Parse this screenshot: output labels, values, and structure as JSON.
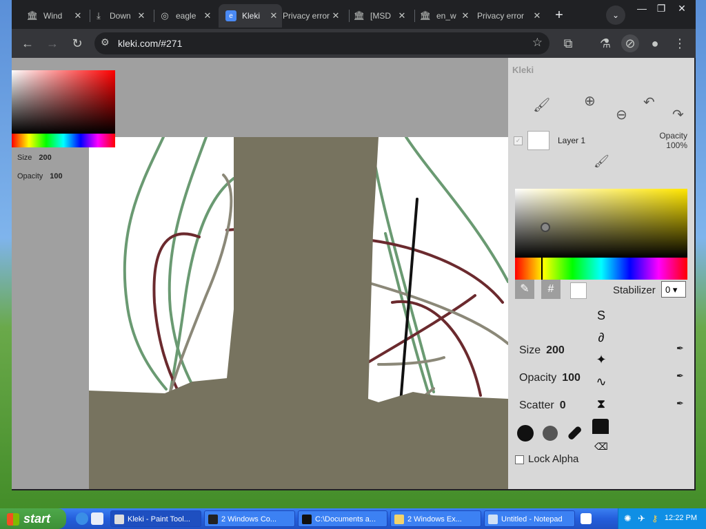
{
  "browser": {
    "tabs": [
      {
        "label": "Wind",
        "icon": "museum-icon"
      },
      {
        "label": "Down",
        "icon": "download-icon"
      },
      {
        "label": "eagle",
        "icon": "globe-icon"
      },
      {
        "label": "Kleki",
        "icon": "kleki-icon",
        "active": true
      },
      {
        "label": "Privacy error",
        "icon": "warning-icon"
      },
      {
        "label": "[MSD",
        "icon": "museum-icon"
      },
      {
        "label": "en_w",
        "icon": "museum-icon"
      },
      {
        "label": "Privacy error",
        "icon": "warning-icon"
      }
    ],
    "new_tab": "+",
    "url": "kleki.com/#271",
    "colors": {
      "frame": "#202124",
      "toolbar": "#35363a"
    }
  },
  "kleki": {
    "logo": "Kleki",
    "left_panel": {
      "size_label": "Size",
      "size_value": "200",
      "opacity_label": "Opacity",
      "opacity_value": "100"
    },
    "layer": {
      "name": "Layer 1",
      "opacity_label": "Opacity",
      "opacity_value": "100%"
    },
    "picker": {
      "hex_button": "#",
      "stabilizer_label": "Stabilizer",
      "stabilizer_value": "0"
    },
    "brush": {
      "size_label": "Size",
      "size_value": "200",
      "opacity_label": "Opacity",
      "opacity_value": "100",
      "scatter_label": "Scatter",
      "scatter_value": "0"
    },
    "lock_alpha": "Lock Alpha",
    "brush_color": "#77735f"
  },
  "taskbar": {
    "start": "start",
    "items": [
      {
        "label": "Kleki - Paint Tool...",
        "active": true
      },
      {
        "label": "2 Windows Co...",
        "active": false
      },
      {
        "label": "C:\\Documents a...",
        "active": false
      },
      {
        "label": "2 Windows Ex...",
        "active": false
      },
      {
        "label": "Untitled - Notepad",
        "active": false
      }
    ],
    "clock": "12:22 PM"
  }
}
